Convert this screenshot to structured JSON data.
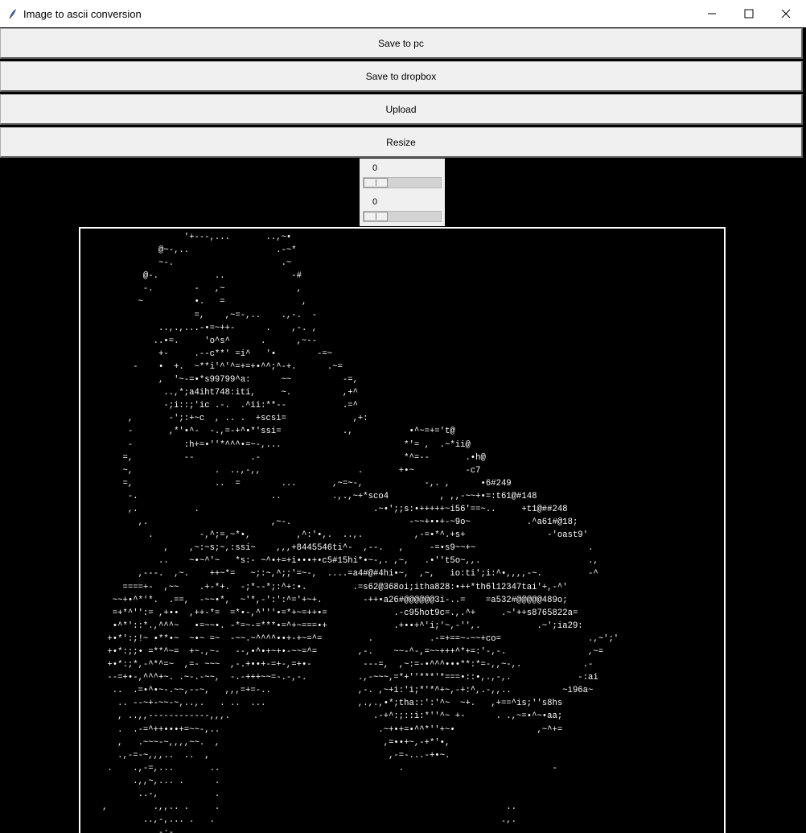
{
  "window": {
    "title": "Image to ascii conversion",
    "icon": "feather-icon"
  },
  "buttons": {
    "save_pc": "Save to pc",
    "save_dropbox": "Save to dropbox",
    "upload": "Upload",
    "resize": "Resize"
  },
  "sliders": {
    "first_value": "0",
    "second_value": "0"
  },
  "ascii_art": "                   '+---,...       ..,~•\n              @~-,..                 .-~*\n              ~-.                     .~\n           @-.           ..             -#\n           -.        -   ,~              ,\n          ~          •.   =               ,\n                     =,    ,~=-,..    .,-.  -\n              ..,.,...-•=~++-      .    ,-. ,\n             ..•=.     'o^s^      .      ,~--\n              +-     .--c**' =i^   '•        -=~\n         -    •  +.  ~**i'^'^=+=+•^^;^-+.      .~=\n              ,  '~-=•*s99799^a:      ~~          -=,\n               ..,*;a4iht748:iti,     ~.          ,+^\n               -;i::;'ic .-.  .^ii:**--           .=^\n        ,       -';:+~c  , .. .  +scsi=             ,+:\n        -       ,*'•^-  -.,=-+^•*'ssi=            .,           •^~=+='t@\n        -          :h+=•''*^^^•=~-,...                        *'= ,  .~*ii@\n       =,          --           .-                            *^=--       .•h@\n       ~,                .  ..,-,,                   .       +•~          -c7\n       =,                ..  =        ...       ,~=~-,            -,. ,      •6#249\n        -.                          ..          .,.,~+*sco4          , ,,-~~+•=:t61@#148\n        ,.           .                                  .~•';;s:•+++++~i56'==~..     +t1@##248\n          ,.                        ,~-.                       -~~+••+-~9o~           .^a61#@18;\n            .         -,^;=,~*•,         ,^:'•,.  ..,.          ,-=•*^.+s+                -'oast9'\n               ,    ,~:~s;~,:ssi~    ,,,+8445546ti^-  ,--.   ,     -=•s9~~+~                      .\n              ..    ~•~^'~   *s:- ~^•+=+i•••+•c5#15hi*•~-,. ,~,   .•''t5o~,,.                     .,\n          ,---.  ,~.    ++~*=   ~;:~,^;;'=~-,  ....=a4#@#4hi•~,  ,~,   io:ti';i:^•,,,,-~.         -^\n       ====+-  ,~~    .+-*+.  -;*--*;:^+:•.         .=s62@368oi;itha828:•++*th6l12347tai'+,-^'\n     ~~+•^*'*.  .==,  -~~•*,  ~'*,-':':^='+~+.        -++•a26#@@@@@@3i-..=    =a532#@@@@@489o;\n     =+*^'':= ,+••  ,++-*=  =*•-,^'''•=*+~=++•=             .-c95hot9c=.,.^+     .~'++s8765822a=\n     •^*'::*.,^^^~   •=~~•. -*=~-=***•=^+~===•+             .+••+^'i;'~,-'',.           .~';ia29:\n    +•*':;!~ •**•~  ~•~ =~  -~~.~^^^^••+-+~=^=         .           .-=+==~-~~+co=                 .,~';'\n    +•*:;;• =**^~=  +~.,~-   --,•^•+~+•-~~=^=        ,-.    ~~-^-,=~~+++^*+=:'-,-.                ,~=\n    +•*:;*,-^*^=~  ,=- ~~~  ,-.+••+-=+-,=+•-          ---=,  ,~:=-•^^^•••**:*=-,,~-,.            .-\n    --=+•-,^^^+~. .~-.-~~,  -.-+++~~=-.-,-.          .,-~~~,=*+''***'*===•::•,.,-,.             -:ai\n     ..  .=•^•~-.~~,--~,   ,,,=+=-..                 ,-. ,~+i:'i;*'*^+~,-+:^,.-,,..          ~i96a~\n      .. --~+-~~-~,..,.   . ..  ...                  ,.,.,•*;tha::':'^~  ~+.   ,+==^is;''s8hs\n      , ..,,------------,,,.                            .-+^:;::i:*''^~ +-      . .,~=•^~•aa;\n      .  .-=^++•••+=~~-,..                               .~+•+=•^^*''+~•                ,~^+=\n      ,   .~~~-~,,,,~~.  ,                                ,=••+~,-+*'•,\n      .,-=-~,,,..  ..  ,                                   ,-=-...-+•~.\n    .    .,-=,...       ..                                   .                             -\n         .,,~,... .      .\n          ..-,           .\n   ,         .,,.. .     .                                                        ..\n           ..,-,... .   .                                                        .,.\n             .-;-........              ..                                       ."
}
